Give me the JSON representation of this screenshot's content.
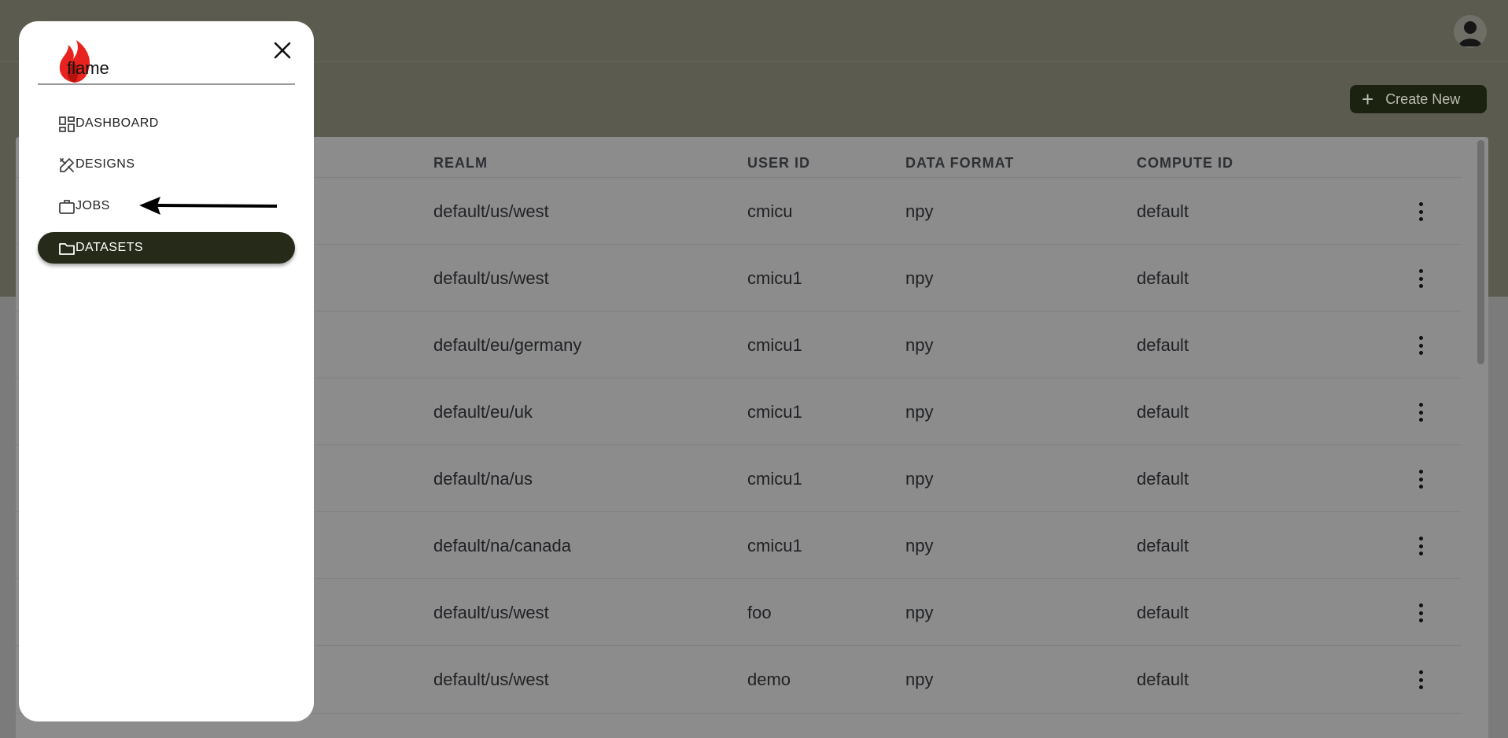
{
  "header": {
    "avatar_icon": "user-avatar-icon"
  },
  "toolbar": {
    "create_label": "Create New",
    "create_icon": "plus-icon"
  },
  "table": {
    "columns": [
      "REALM",
      "USER ID",
      "DATA FORMAT",
      "COMPUTE ID"
    ],
    "rows": [
      {
        "realm": "default/us/west",
        "user_id": "cmicu",
        "data_format": "npy",
        "compute_id": "default"
      },
      {
        "realm": "default/us/west",
        "user_id": "cmicu1",
        "data_format": "npy",
        "compute_id": "default"
      },
      {
        "realm": "default/eu/germany",
        "user_id": "cmicu1",
        "data_format": "npy",
        "compute_id": "default"
      },
      {
        "realm": "default/eu/uk",
        "user_id": "cmicu1",
        "data_format": "npy",
        "compute_id": "default"
      },
      {
        "realm": "default/na/us",
        "user_id": "cmicu1",
        "data_format": "npy",
        "compute_id": "default"
      },
      {
        "realm": "default/na/canada",
        "user_id": "cmicu1",
        "data_format": "npy",
        "compute_id": "default"
      },
      {
        "realm": "default/us/west",
        "user_id": "foo",
        "data_format": "npy",
        "compute_id": "default"
      },
      {
        "realm": "default/us/west",
        "user_id": "demo",
        "data_format": "npy",
        "compute_id": "default"
      }
    ],
    "row_menu_icon": "more-vertical-icon"
  },
  "drawer": {
    "logo_text": "flame",
    "close_icon": "close-icon",
    "items": [
      {
        "label": "DASHBOARD",
        "icon": "dashboard-icon"
      },
      {
        "label": "DESIGNS",
        "icon": "design-tools-icon"
      },
      {
        "label": "JOBS",
        "icon": "briefcase-icon"
      },
      {
        "label": "DATASETS",
        "icon": "folder-icon",
        "active": true
      }
    ]
  },
  "annotation": {
    "arrow_icon": "arrow-left-icon",
    "points_to": "JOBS"
  },
  "colors": {
    "active_nav_bg": "#262a18",
    "create_button_bg": "#1c2210",
    "header_bg": "#5b5b50",
    "logo_flame": "#e8231f"
  }
}
